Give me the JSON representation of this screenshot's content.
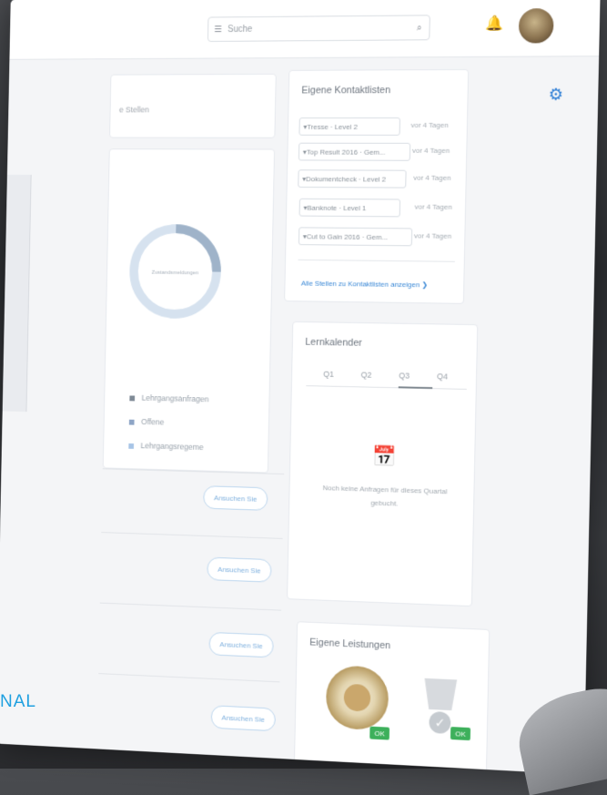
{
  "header": {
    "search_placeholder": "Suche",
    "menu_icon": "menu-icon",
    "search_icon": "search-icon",
    "bell_icon": "bell-icon",
    "avatar_icon": "avatar"
  },
  "left": {
    "card_text": "e Stellen",
    "donut_center": "Zustandsmeldungen",
    "legend": [
      {
        "label": "Lehrgangsanfragen",
        "color": "#7f8a96"
      },
      {
        "label": "Offene",
        "color": "#8ea5c6"
      },
      {
        "label": "Lehrgangsregeme",
        "color": "#a7c4e6"
      }
    ],
    "buttons": [
      "Ansuchen Sie",
      "Ansuchen Sie",
      "Ansuchen Sie",
      "Ansuchen Sie"
    ]
  },
  "kontakt": {
    "title": "Eigene Kontaktlisten",
    "items": [
      {
        "label": "Tresse · Level 2",
        "time": "vor 4 Tagen"
      },
      {
        "label": "Top Result 2016 · Gem...",
        "time": "vor 4 Tagen"
      },
      {
        "label": "Dokumentcheck · Level 2",
        "time": "vor 4 Tagen"
      },
      {
        "label": "Banknote · Level 1",
        "time": "vor 4 Tagen"
      },
      {
        "label": "Cut to Gain 2016 · Gem...",
        "time": "vor 4 Tagen"
      }
    ],
    "link": "Alle Stellen zu Kontaktlisten anzeigen"
  },
  "lern": {
    "title": "Lernkalender",
    "tabs": [
      "Q1",
      "Q2",
      "Q3",
      "Q4"
    ],
    "empty": "Noch keine Anfragen für dieses Quartal gebucht."
  },
  "leist": {
    "title": "Eigene Leistungen",
    "ok_label": "OK"
  },
  "footer": {
    "text": "NAL"
  },
  "colors": {
    "accent": "#2f7fd6",
    "success": "#3db05b"
  }
}
